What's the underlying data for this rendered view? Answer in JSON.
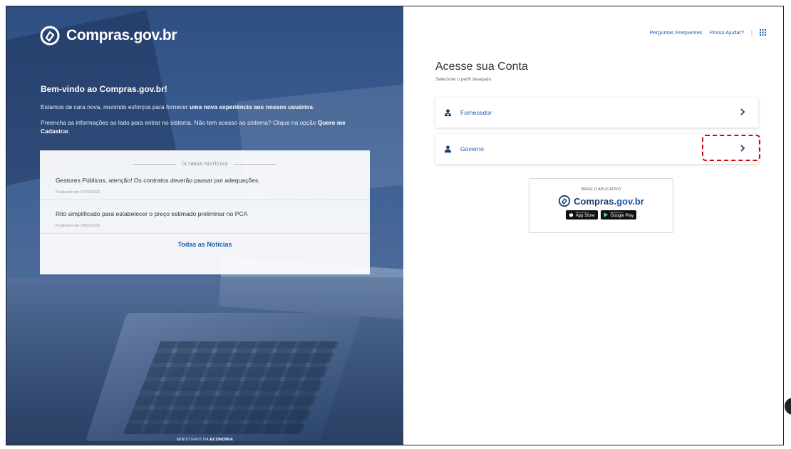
{
  "left": {
    "brand": "Compras.gov.br",
    "welcome": "Bem-vindo ao Compras.gov.br!",
    "intro1_prefix": "Estamos de cara nova, reunindo esforços para fornecer ",
    "intro1_bold": "uma nova experiência aos nossos usuários",
    "intro1_suffix": ".",
    "intro2_prefix": "Preencha as informações ao lado para entrar no sistema. Não tem acesso ao sistema? Clique na opção ",
    "intro2_bold": "Quero me Cadastrar",
    "intro2_suffix": ".",
    "news": {
      "header": "ÚLTIMAS NOTÍCIAS",
      "items": [
        {
          "title": "Gestores Públicos, atenção! Os contratos deverão passar por adequações.",
          "date": "Publicado em 07/02/2022"
        },
        {
          "title": "Rito simplificado para estabelecer o preço estimado preliminar no PCA",
          "date": "Publicado em 28/01/2022"
        }
      ],
      "all_link": "Todas as Notícias"
    },
    "ministry_prefix": "MINISTÉRIO DA ",
    "ministry_bold": "ECONOMIA"
  },
  "right": {
    "nav": {
      "faq": "Perguntas Frequentes",
      "help": "Posso Ajudar?",
      "sep": "|"
    },
    "title": "Acesse sua Conta",
    "subtitle": "Selecione o perfil desejado.",
    "profiles": [
      {
        "label": "Fornecedor",
        "icon": "supplier-icon"
      },
      {
        "label": "Governo",
        "icon": "user-icon"
      }
    ],
    "app": {
      "download_label": "BAIXE O APLICATIVO",
      "brand_main": "Compras.",
      "brand_tld": "gov.br",
      "appstore_small": "Disponível na",
      "appstore": "App Store",
      "googleplay_small": "Disponível no",
      "googleplay": "Google Play"
    }
  },
  "colors": {
    "link": "#1c5fb3",
    "highlight": "#d80000",
    "panel": "#3d5f93"
  }
}
